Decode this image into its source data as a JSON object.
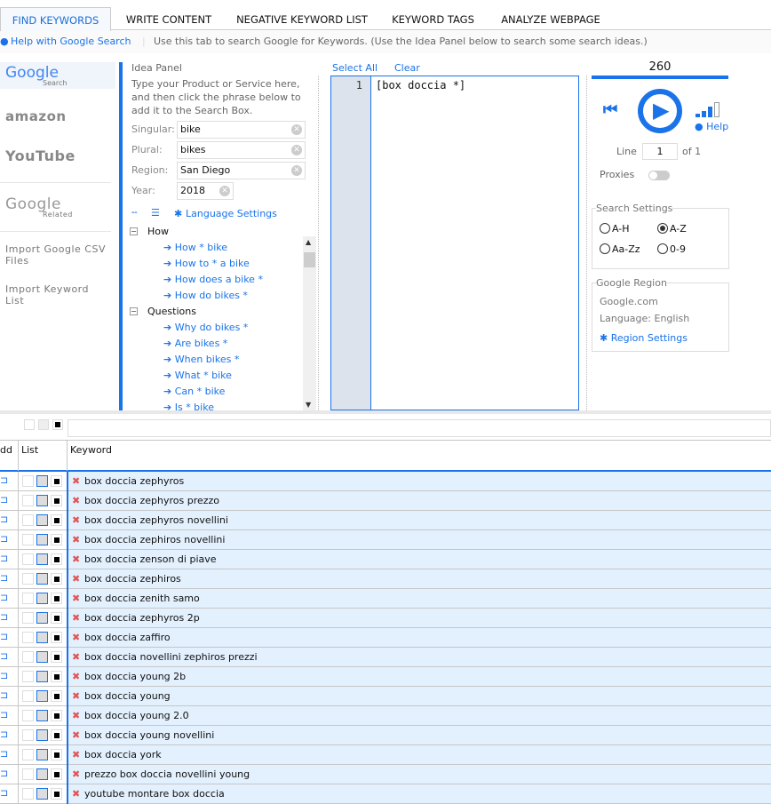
{
  "tabs": [
    "FIND KEYWORDS",
    "WRITE CONTENT",
    "NEGATIVE KEYWORD LIST",
    "KEYWORD TAGS",
    "ANALYZE WEBPAGE"
  ],
  "helpbar": {
    "link": "Help with Google Search",
    "text": "Use this tab to search Google for Keywords. (Use the Idea Panel below to search some search ideas.)"
  },
  "sidebar": {
    "google": "Google",
    "google_sub": "Search",
    "amazon": "amazon",
    "youtube": "YouTube",
    "google_related": "Google",
    "related_sub": "Related",
    "import_csv": "Import Google CSV Files",
    "import_list": "Import Keyword List"
  },
  "idea": {
    "title": "Idea Panel",
    "desc": "Type your Product or Service here, and then click the phrase below to add it to the Search Box.",
    "singular_label": "Singular:",
    "singular": "bike",
    "plural_label": "Plural:",
    "plural": "bikes",
    "region_label": "Region:",
    "region": "San Diego",
    "year_label": "Year:",
    "year": "2018",
    "lang": "Language Settings",
    "groups": [
      {
        "name": "How",
        "items": [
          "How * bike",
          "How to * a bike",
          "How does a bike *",
          "How do bikes *"
        ]
      },
      {
        "name": "Questions",
        "items": [
          "Why do bikes *",
          "Are bikes *",
          "When bikes *",
          "What * bike",
          "Can * bike",
          "Is * bike"
        ]
      }
    ]
  },
  "editor": {
    "select_all": "Select All",
    "clear": "Clear",
    "line_no": "1",
    "text": "[box doccia *]"
  },
  "control": {
    "count": "260",
    "help": "Help",
    "line_label": "Line",
    "line": "1",
    "of": "of 1",
    "proxies": "Proxies",
    "proxies_on": false,
    "search_settings": "Search Settings",
    "options": [
      "A-H",
      "A-Z",
      "Aa-Zz",
      "0-9"
    ],
    "selected": "A-Z",
    "region_title": "Google Region",
    "domain": "Google.com",
    "language": "Language: English",
    "region_settings": "Region Settings"
  },
  "grid": {
    "col_add": "dd",
    "col_list": "List",
    "col_keyword": "Keyword",
    "rows": [
      "box doccia zephyros",
      "box doccia zephyros prezzo",
      "box doccia zephyros novellini",
      "box doccia zephiros novellini",
      "box doccia zenson di piave",
      "box doccia zephiros",
      "box doccia zenith samo",
      "box doccia zephyros 2p",
      "box doccia zaffiro",
      "box doccia novellini zephiros prezzi",
      "box doccia young 2b",
      "box doccia young",
      "box doccia young 2.0",
      "box doccia young novellini",
      "box doccia york",
      "prezzo box doccia novellini young",
      "youtube montare box doccia"
    ]
  },
  "colors": {
    "accent": "#1a73e8",
    "row_bg": "#e3f0fd",
    "remove": "#e05555"
  }
}
